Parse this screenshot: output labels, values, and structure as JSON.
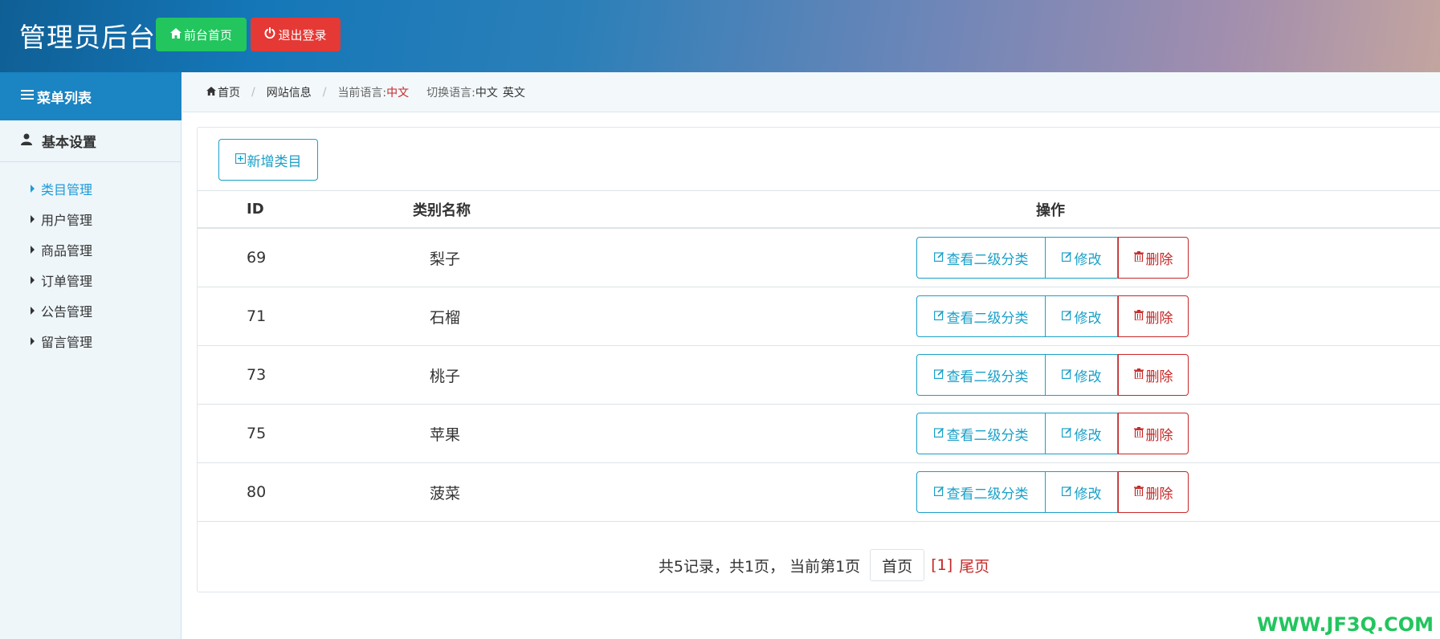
{
  "header": {
    "title": "管理员后台",
    "front_label": "前台首页",
    "logout_label": "退出登录"
  },
  "sidebar": {
    "title": "菜单列表",
    "group": "基本设置",
    "items": [
      {
        "label": "类目管理",
        "active": true
      },
      {
        "label": "用户管理",
        "active": false
      },
      {
        "label": "商品管理",
        "active": false
      },
      {
        "label": "订单管理",
        "active": false
      },
      {
        "label": "公告管理",
        "active": false
      },
      {
        "label": "留言管理",
        "active": false
      }
    ]
  },
  "breadcrumb": {
    "home": "首页",
    "site_info": "网站信息",
    "current_lang_label": "当前语言:",
    "current_lang": "中文",
    "switch_lang_label": "切换语言:",
    "lang_zh": "中文",
    "lang_en": "英文"
  },
  "toolbar": {
    "add_label": "新增类目"
  },
  "table": {
    "headers": {
      "id": "ID",
      "name": "类别名称",
      "ops": "操作"
    },
    "view_label": "查看二级分类",
    "edit_label": "修改",
    "delete_label": "删除",
    "rows": [
      {
        "id": "69",
        "name": "梨子"
      },
      {
        "id": "71",
        "name": "石榴"
      },
      {
        "id": "73",
        "name": "桃子"
      },
      {
        "id": "75",
        "name": "苹果"
      },
      {
        "id": "80",
        "name": "菠菜"
      }
    ]
  },
  "pager": {
    "info": "共5记录，共1页，  当前第1页",
    "first": "首页",
    "current": "[1]",
    "last": "尾页"
  },
  "watermark": "WWW.JF3Q.COM",
  "colors": {
    "primary": "#1aa0c8",
    "danger": "#c62828",
    "success": "#22c55e",
    "sidebar_title": "#1b84c2"
  }
}
